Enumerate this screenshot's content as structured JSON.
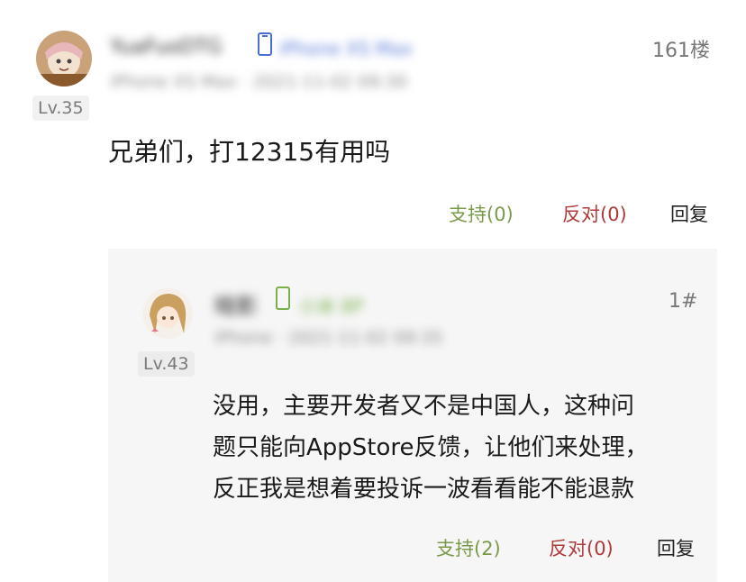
{
  "post": {
    "username": "YuaFuoDTG",
    "device": "iPhone XS Max",
    "meta": "iPhone XS Max · 2021-11-02 09:30",
    "level": "Lv.35",
    "floor": "161楼",
    "content": "兄弟们，打12315有用吗",
    "support_label": "支持(0)",
    "oppose_label": "反对(0)",
    "reply_label": "回复"
  },
  "reply": {
    "username": "暗影",
    "device": "小米 8P",
    "meta": "iPhone · 2021-11-02 09:35",
    "level": "Lv.43",
    "floor": "1#",
    "content_lines": [
      "没用，主要开发者又不是中国人，这种问",
      "题只能向AppStore反馈，让他们来处理，",
      "反正我是想着要投诉一波看看能不能退款"
    ],
    "support_label": "支持(2)",
    "oppose_label": "反对(0)",
    "reply_label": "回复"
  },
  "colors": {
    "support": "#7a9a4a",
    "oppose": "#b03a3a",
    "reply_bg": "#f6f6f6"
  }
}
